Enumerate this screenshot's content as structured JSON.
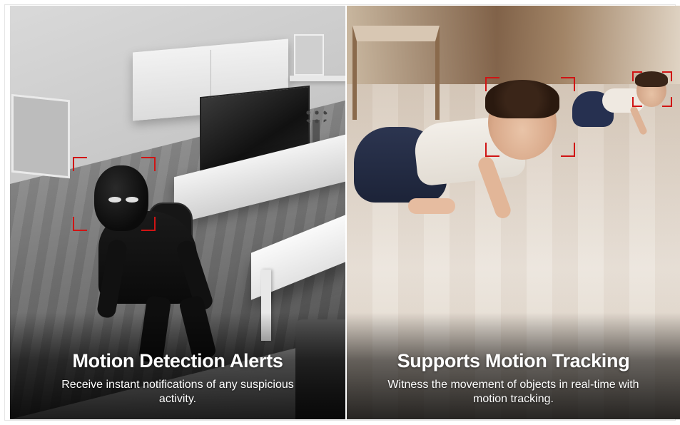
{
  "panels": {
    "left": {
      "title": "Motion Detection Alerts",
      "description": "Receive instant notifications of any suspicious activity."
    },
    "right": {
      "title": "Supports Motion Tracking",
      "description": "Witness the movement of objects in real-time with motion tracking."
    }
  },
  "colors": {
    "bracket": "#d01414",
    "caption_text": "#ffffff"
  }
}
